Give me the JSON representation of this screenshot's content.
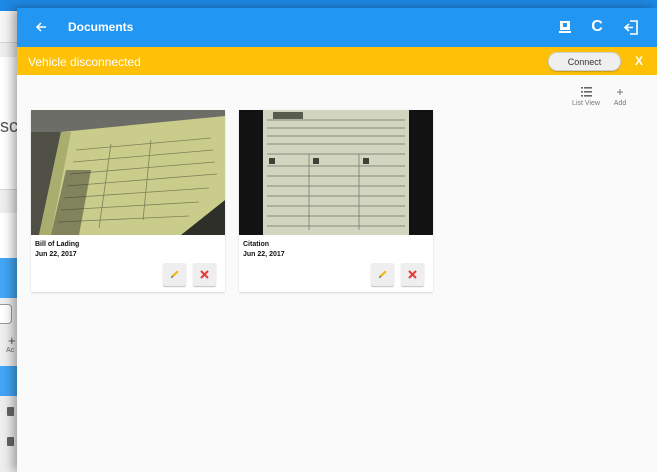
{
  "colors": {
    "appbar": "#2196f3",
    "banner": "#ffc107",
    "delete_accent": "#e53935",
    "edit_accent": "#f4b400"
  },
  "appbar": {
    "title": "Documents",
    "back_icon": "arrow-left-icon",
    "actions": [
      {
        "icon": "device-eld-icon"
      },
      {
        "icon": "refresh-icon",
        "glyph": "C"
      },
      {
        "icon": "logout-icon"
      }
    ]
  },
  "banner": {
    "message": "Vehicle disconnected",
    "connect_label": "Connect",
    "close_label": "X"
  },
  "toolbar": {
    "list_view": {
      "icon": "list-icon",
      "label": "List View"
    },
    "add": {
      "icon": "plus-icon",
      "glyph": "+",
      "label": "Add"
    }
  },
  "documents": [
    {
      "name": "Bill of Lading",
      "date": "Jun 22, 2017"
    },
    {
      "name": "Citation",
      "date": "Jun 22, 2017"
    }
  ],
  "background": {
    "partial_text": "sc",
    "plus_glyph": "+",
    "plus_label": "Ac"
  }
}
